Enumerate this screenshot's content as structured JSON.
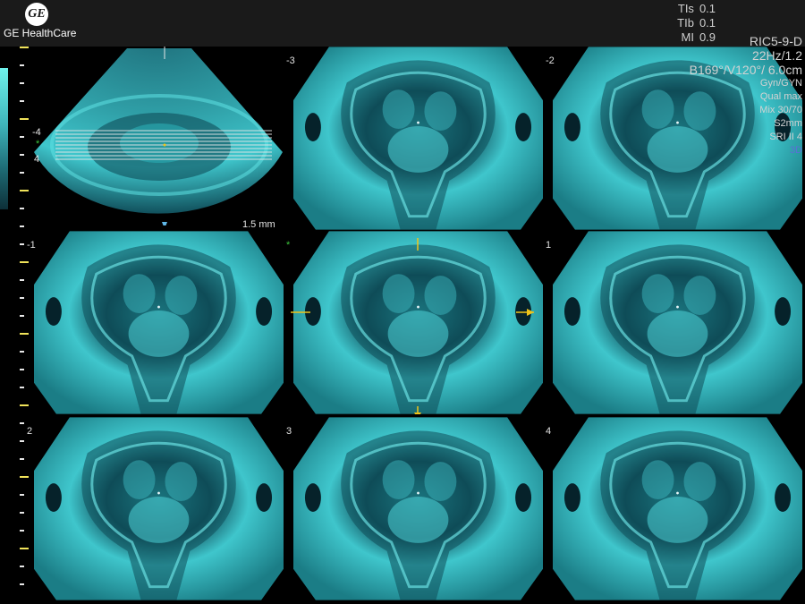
{
  "header": {
    "brand": "GE HealthCare",
    "logo_text": "GE",
    "tis_label": "TIs",
    "tis_value": "0.1",
    "tib_label": "TIb",
    "tib_value": "0.1",
    "mi_label": "MI",
    "mi_value": "0.9"
  },
  "params": {
    "probe": "RIC5-9-D",
    "frame_rate": "22Hz/1.2",
    "angles": "B169°/V120°/ 6.0cm",
    "preset": "Gyn/GYN",
    "quality": "Qual max",
    "mix": "Mix 30/70",
    "slice": "S2mm",
    "sri": "SRI II 4",
    "mode": "3D"
  },
  "reference": {
    "slice_spacing": "1.5 mm",
    "label_top": "-4",
    "label_mid": "*",
    "label_bottom": "4"
  },
  "slices": [
    {
      "label": "-3"
    },
    {
      "label": "-2"
    },
    {
      "label": "-1"
    },
    {
      "label": "*"
    },
    {
      "label": "1"
    },
    {
      "label": "2"
    },
    {
      "label": "3"
    },
    {
      "label": "4"
    }
  ],
  "colors": {
    "tissue": "#3fc6cc",
    "tissue_dark": "#0f4c58",
    "marker": "#f0c419",
    "center_marker": "#3cc43c",
    "frame": "#1a1a1a"
  },
  "icons": {
    "logo": "ge-monogram-icon",
    "center": "asterisk-icon",
    "crosshair": "arrow-marker-icon"
  }
}
